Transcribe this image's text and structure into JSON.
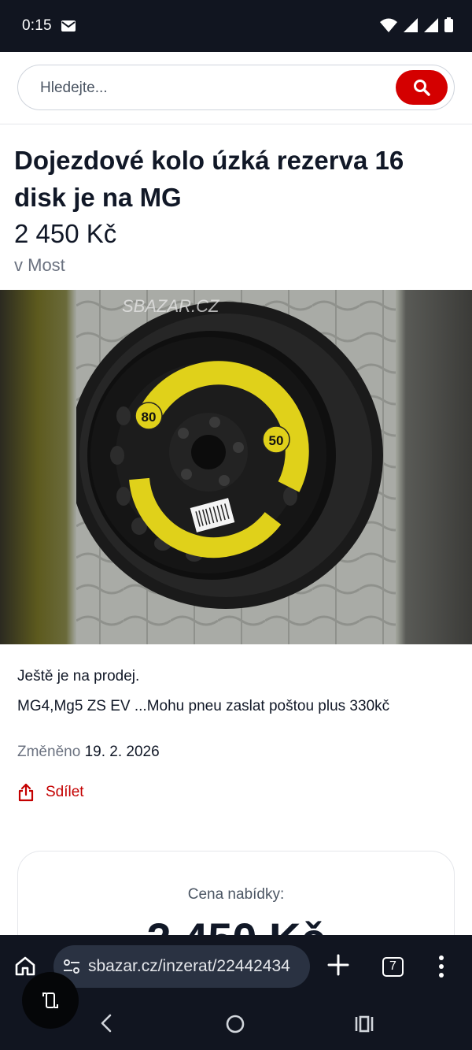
{
  "status_bar": {
    "time": "0:15"
  },
  "search": {
    "placeholder": "Hledejte..."
  },
  "listing": {
    "title": "Dojezdové kolo úzká rezerva 16 disk je na MG",
    "price": "2 450 Kč",
    "location": "v Most",
    "watermark": "SBAZAR.CZ",
    "availability": "Ještě je na prodej.",
    "description": "MG4,Mg5 ZS EV ...Mohu pneu zaslat poštou plus 330kč",
    "changed_label": "Změněno",
    "changed_date": "19. 2. 2026",
    "share_label": "Sdílet",
    "speed_label_left": "80",
    "speed_label_right": "50"
  },
  "offer": {
    "label": "Cena nabídky:",
    "price": "2 450 Kč"
  },
  "browser": {
    "url": "sbazar.cz/inzerat/22442434",
    "tab_count": "7"
  },
  "colors": {
    "accent": "#d40000",
    "share": "#c40000",
    "dark_bar": "#111520"
  }
}
